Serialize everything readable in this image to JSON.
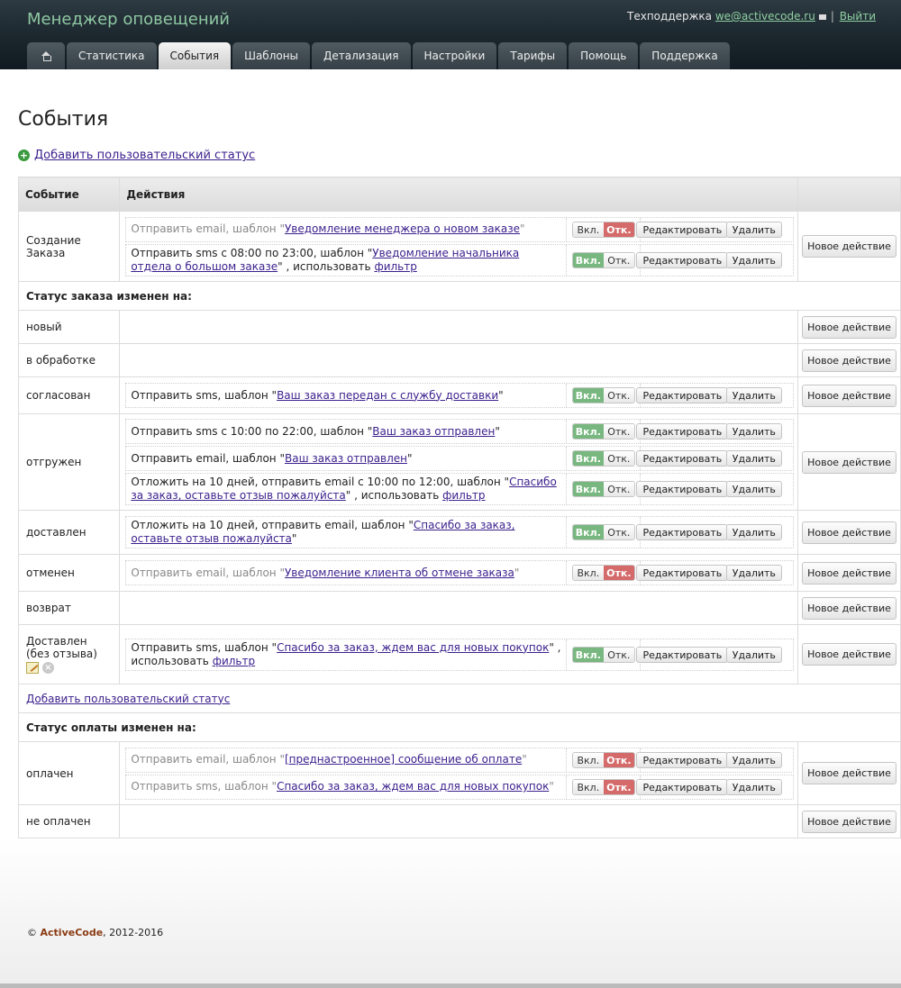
{
  "header": {
    "app_title": "Менеджер оповещений",
    "support_label": "Техподдержка",
    "support_email": "we@activecode.ru",
    "separator": "|",
    "logout": "Выйти"
  },
  "tabs": [
    {
      "label": "Статистика"
    },
    {
      "label": "События"
    },
    {
      "label": "Шаблоны"
    },
    {
      "label": "Детализация"
    },
    {
      "label": "Настройки"
    },
    {
      "label": "Тарифы"
    },
    {
      "label": "Помощь"
    },
    {
      "label": "Поддержка"
    }
  ],
  "page": {
    "title": "События",
    "add_status_top": "Добавить пользовательский статус",
    "add_status_mid": "Добавить пользовательский статус"
  },
  "table": {
    "col_event": "Событие",
    "col_actions": "Действия"
  },
  "common": {
    "on": "Вкл.",
    "off": "Отк.",
    "edit": "Редактировать",
    "delete": "Удалить",
    "new_action": "Новое действие",
    "filter": "фильтр"
  },
  "sections": {
    "order_status": "Статус заказа изменен на:",
    "payment_status": "Статус оплаты изменен на:"
  },
  "events": {
    "create": {
      "name": "Создание Заказа",
      "a1": {
        "pre": "Отправить email, шаблон \"",
        "link": "Уведомление менеджера о новом заказе",
        "post": "\""
      },
      "a2": {
        "pre": "Отправить sms с 08:00 по 23:00, шаблон \"",
        "link": "Уведомление начальника отдела о большом заказе",
        "post": "\" , использовать "
      }
    },
    "new": {
      "name": "новый"
    },
    "processing": {
      "name": "в обработке"
    },
    "agreed": {
      "name": "согласован",
      "a1": {
        "pre": "Отправить sms, шаблон \"",
        "link": "Ваш заказ передан с службу доставки",
        "post": "\""
      }
    },
    "shipped": {
      "name": "отгружен",
      "a1": {
        "pre": "Отправить sms с 10:00 по 22:00, шаблон \"",
        "link": "Ваш заказ отправлен",
        "post": "\""
      },
      "a2": {
        "pre": "Отправить email, шаблон \"",
        "link": "Ваш заказ отправлен",
        "post": "\""
      },
      "a3": {
        "pre": "Отложить на 10 дней, отправить email с 10:00 по 12:00, шаблон \"",
        "link": "Спасибо за заказ, оставьте отзыв пожалуйста",
        "post": "\" , использовать "
      }
    },
    "delivered": {
      "name": "доставлен",
      "a1": {
        "pre": "Отложить на 10 дней, отправить email, шаблон \"",
        "link": "Спасибо за заказ, оставьте отзыв пожалуйста",
        "post": "\""
      }
    },
    "cancelled": {
      "name": "отменен",
      "a1": {
        "pre": "Отправить email, шаблон \"",
        "link": "Уведомление клиента об отмене заказа",
        "post": "\""
      }
    },
    "returned": {
      "name": "возврат"
    },
    "delivered_noreview": {
      "name": "Доставлен (без отзыва)",
      "a1": {
        "pre": "Отправить sms, шаблон \"",
        "link": "Спасибо за заказ, ждем вас для новых покупок",
        "post": "\" , использовать "
      }
    },
    "paid": {
      "name": "оплачен",
      "a1": {
        "pre": "Отправить email, шаблон \"",
        "link": "[преднастроенное] сообщение об оплате",
        "post": "\""
      },
      "a2": {
        "pre": "Отправить sms, шаблон \"",
        "link": "Спасибо за заказ, ждем вас для новых покупок",
        "post": "\""
      }
    },
    "unpaid": {
      "name": "не оплачен"
    }
  },
  "footer": {
    "copyright": "©",
    "brand": "ActiveCode",
    "years": ", 2012-2016"
  }
}
